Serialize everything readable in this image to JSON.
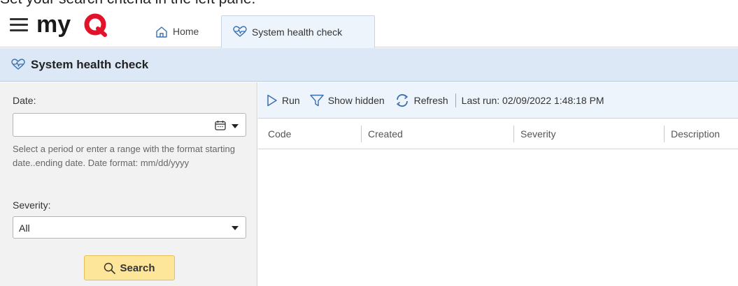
{
  "caption": "Set your search criteria in the left pane.",
  "app": {
    "brand": "myQ",
    "brand_color": "#e3122b",
    "accent_color": "#dce8f5"
  },
  "tabs": [
    {
      "label": "Home",
      "icon": "home-icon",
      "active": false
    },
    {
      "label": "System health check",
      "icon": "heart-pulse-icon",
      "active": true
    }
  ],
  "page": {
    "title": "System health check",
    "icon": "heart-pulse-icon"
  },
  "filters": {
    "date_label": "Date:",
    "date_value": "",
    "date_hint": "Select a period or enter a range with the format starting date..ending date. Date format: mm/dd/yyyy",
    "severity_label": "Severity:",
    "severity_value": "All",
    "search_label": "Search"
  },
  "toolbar": {
    "run_label": "Run",
    "show_hidden_label": "Show hidden",
    "refresh_label": "Refresh",
    "last_run": "Last run: 02/09/2022 1:48:18 PM"
  },
  "grid": {
    "columns": [
      "Code",
      "Created",
      "Severity",
      "Description"
    ],
    "rows": []
  }
}
